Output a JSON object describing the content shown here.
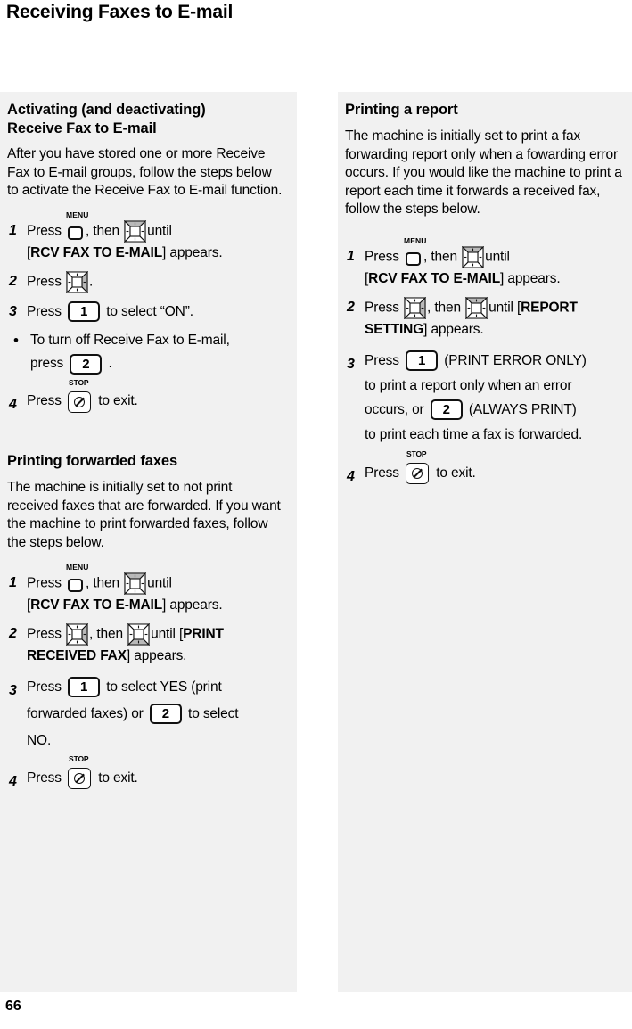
{
  "page": {
    "title": "Receiving Faxes to E-mail",
    "number": "66"
  },
  "keys": {
    "menu_caption": "MENU",
    "stop_caption": "STOP",
    "one": "1",
    "two": "2"
  },
  "left_panel": {
    "heading_line1": "Activating (and deactivating)",
    "heading_line2": "Receive Fax to E-mail",
    "intro": "After you have stored one or more Receive Fax to E-mail groups, follow the steps below to activate the Receive Fax to E-mail function.",
    "steps": [
      {
        "num": "1",
        "t1": "Press",
        "t2": ", then",
        "t3": "until",
        "line2_pre": "[",
        "line2_bold": "RCV FAX TO E-MAIL",
        "line2_post": "] appears."
      },
      {
        "num": "2",
        "t1": "Press",
        "t2": "."
      },
      {
        "num": "3",
        "t1": "Press",
        "t2": "to select “ON”."
      },
      {
        "bullet": "•",
        "t1": "To turn off Receive Fax to E-mail,",
        "t2": "press",
        "t3": "."
      },
      {
        "num": "4",
        "t1": "Press",
        "t2": "to exit."
      }
    ],
    "heading2": "Printing forwarded faxes",
    "intro2": "The machine is initially set to not print received faxes that are forwarded. If you want the machine to print forwarded faxes, follow the steps below.",
    "steps2": [
      {
        "num": "1",
        "t1": "Press",
        "t2": ", then",
        "t3": "until",
        "line2_pre": "[",
        "line2_bold": "RCV FAX TO E-MAIL",
        "line2_post": "] appears."
      },
      {
        "num": "2",
        "t1": "Press",
        "t2": ", then",
        "t3": "until [",
        "t4_bold": "PRINT",
        "line2_bold": "RECEIVED FAX",
        "line2_post": "] appears."
      },
      {
        "num": "3",
        "t1": "Press",
        "t2": "to select YES (print",
        "t3": "forwarded faxes) or",
        "t4": "to select",
        "t5": "NO."
      },
      {
        "num": "4",
        "t1": "Press",
        "t2": "to exit."
      }
    ]
  },
  "right_panel": {
    "heading": "Printing a report",
    "intro": "The machine is initially set to print a fax forwarding report only when a fowarding error occurs. If you would like the machine to print a report each time it forwards a received fax, follow the steps below.",
    "steps": [
      {
        "num": "1",
        "t1": "Press",
        "t2": ", then",
        "t3": "until",
        "line2_pre": "[",
        "line2_bold": "RCV FAX TO E-MAIL",
        "line2_post": "] appears."
      },
      {
        "num": "2",
        "t1": "Press",
        "t2": ", then",
        "t3": "until [",
        "t4_bold": "REPORT",
        "line2_bold": "SETTING",
        "line2_post": "] appears."
      },
      {
        "num": "3",
        "t1": "Press",
        "t2": "(PRINT ERROR ONLY)",
        "t3": "to print a report only when an error",
        "t4": "occurs, or",
        "t5": "(ALWAYS PRINT)",
        "t6": "to print each time a fax is forwarded."
      },
      {
        "num": "4",
        "t1": "Press",
        "t2": "to exit."
      }
    ]
  }
}
